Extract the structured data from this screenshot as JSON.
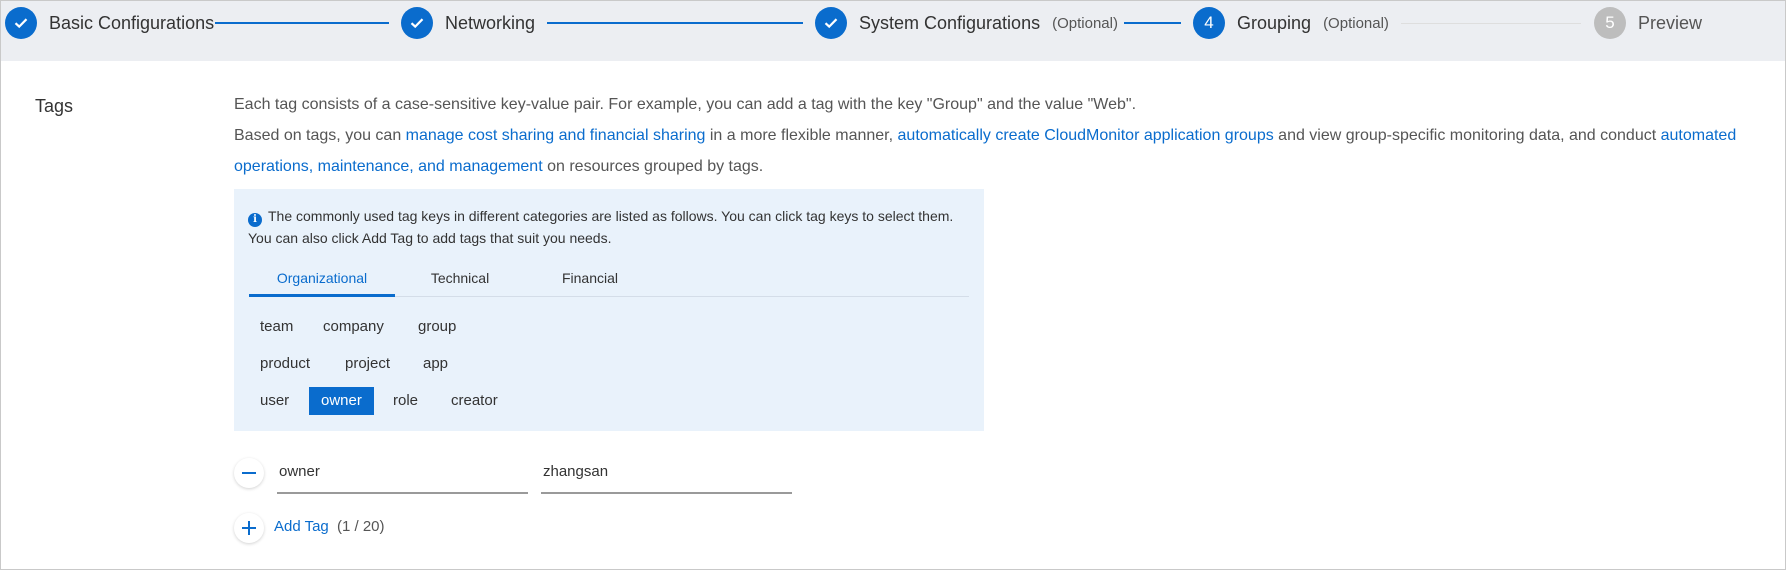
{
  "stepper": {
    "steps": [
      {
        "number": "1",
        "label": "Basic Configurations",
        "status": "done"
      },
      {
        "number": "2",
        "label": "Networking",
        "status": "done"
      },
      {
        "number": "3",
        "label": "System Configurations",
        "optional": "(Optional)",
        "status": "done"
      },
      {
        "number": "4",
        "label": "Grouping",
        "optional": "(Optional)",
        "status": "active"
      },
      {
        "number": "5",
        "label": "Preview",
        "status": "todo"
      }
    ]
  },
  "tags_section": {
    "label": "Tags",
    "description": {
      "line1": "Each tag consists of a case-sensitive key-value pair. For example, you can add a tag with the key \"Group\" and the value \"Web\".",
      "line2_prefix": "Based on tags, you can ",
      "link_cost": "manage cost sharing and financial sharing",
      "line2_mid": " in a more flexible manner, ",
      "link_cloudmonitor": "automatically create CloudMonitor application groups",
      "line2_mid2": " and view group-specific monitoring data, and conduct ",
      "link_automated": "automated operations, maintenance, and management",
      "line2_suffix": " on resources grouped by tags."
    },
    "panel": {
      "info": "The commonly used tag keys in different categories are listed as follows. You can click tag keys to select them. You can also click Add Tag to add tags that suit you needs.",
      "tabs": [
        "Organizational",
        "Technical",
        "Financial"
      ],
      "active_tab": "Organizational",
      "keys": {
        "row1": [
          "team",
          "company",
          "group"
        ],
        "row2": [
          "product",
          "project",
          "app"
        ],
        "row3": [
          "user",
          "owner",
          "role",
          "creator"
        ]
      },
      "selected_key": "owner"
    },
    "tag_row": {
      "key": "owner",
      "value": "zhangsan"
    },
    "add_tag": {
      "label": "Add Tag",
      "count": "(1 / 20)"
    }
  },
  "colors": {
    "accent": "#0a6ccd",
    "panel_bg": "#e9f2fb",
    "header_bg": "#eceef2"
  }
}
